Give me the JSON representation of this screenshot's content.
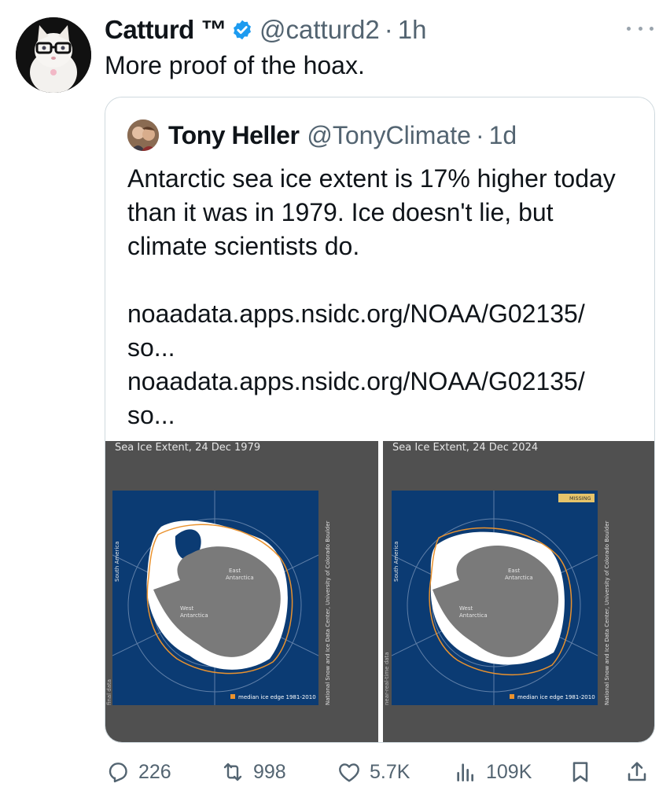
{
  "tweet": {
    "author_name": "Catturd ™",
    "handle": "@catturd2",
    "separator": "·",
    "time": "1h",
    "text": "More proof of the hoax."
  },
  "quoted": {
    "author_name": "Tony Heller",
    "handle": "@TonyClimate",
    "separator": "·",
    "time": "1d",
    "text_lines": [
      "Antarctic sea ice extent is 17% higher today",
      "than it was in 1979.  Ice doesn't lie, but",
      "climate scientists do."
    ],
    "links": [
      "noaadata.apps.nsidc.org/NOAA/G02135/",
      "so...",
      "noaadata.apps.nsidc.org/NOAA/G02135/",
      "so..."
    ],
    "images": [
      {
        "title": "Sea Ice Extent, 24 Dec 1979",
        "continent_label": "South America",
        "east_label_1": "East",
        "east_label_2": "Antarctica",
        "west_label_1": "West",
        "west_label_2": "Antarctica",
        "legend": "median ice edge 1981-2010",
        "source": "National Snow and Ice Data Center, University of Colorado Boulder",
        "corner": "final data",
        "missing": ""
      },
      {
        "title": "Sea Ice Extent, 24 Dec 2024",
        "continent_label": "South America",
        "east_label_1": "East",
        "east_label_2": "Antarctica",
        "west_label_1": "West",
        "west_label_2": "Antarctica",
        "legend": "median ice edge 1981-2010",
        "source": "National Snow and Ice Data Center, University of Colorado Boulder",
        "corner": "near-real-time data",
        "missing": "MISSING"
      }
    ]
  },
  "actions": {
    "replies": "226",
    "reposts": "998",
    "likes": "5.7K",
    "views": "109K"
  },
  "colors": {
    "verified": "#1d9bf0",
    "ocean": "#0b3b73",
    "land": "#7a7a7a",
    "ice": "#ffffff",
    "median_edge": "#e9922e",
    "panel": "#505050"
  },
  "icons": [
    "verified-badge-icon",
    "more-icon",
    "reply-icon",
    "repost-icon",
    "like-icon",
    "views-icon",
    "bookmark-icon",
    "share-icon"
  ]
}
